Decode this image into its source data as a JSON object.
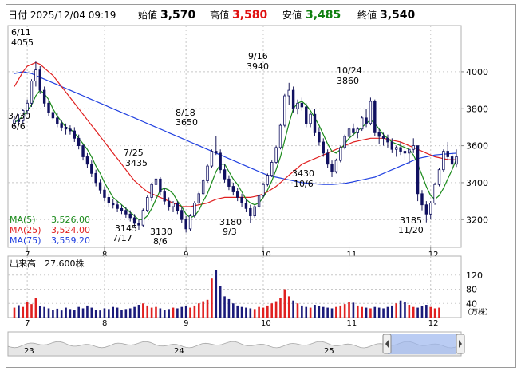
{
  "header": {
    "datetime_label": "日付 2025/12/04 09:19",
    "open_label": "始値",
    "open_value": "3,570",
    "high_label": "高値",
    "high_value": "3,580",
    "low_label": "安値",
    "low_value": "3,485",
    "close_label": "終値",
    "close_value": "3,540",
    "high_color": "#e01010",
    "low_color": "#108010"
  },
  "legend": {
    "ma5": "MA(5)",
    "ma5_value": "3,526.00",
    "ma25": "MA(25)",
    "ma25_value": "3,524.00",
    "ma75": "MA(75)",
    "ma75_value": "3,559.20",
    "ma5_color": "#1a8a1a",
    "ma25_color": "#e02020",
    "ma75_color": "#2040e0"
  },
  "annotations": [
    {
      "text": "6/11",
      "price": "4055"
    },
    {
      "text": "3730",
      "price": "6/6"
    },
    {
      "text": "7/25",
      "price": "3435"
    },
    {
      "text": "3145",
      "price": "7/17"
    },
    {
      "text": "8/18",
      "price": "3650"
    },
    {
      "text": "3130",
      "price": "8/6"
    },
    {
      "text": "9/16",
      "price": "3940"
    },
    {
      "text": "3180",
      "price": "9/3"
    },
    {
      "text": "10/24",
      "price": "3860"
    },
    {
      "text": "3430",
      "price": "10/6"
    },
    {
      "text": "3185",
      "price": "11/20"
    }
  ],
  "volume_panel": {
    "title": "出来高",
    "value": "27,600株",
    "unit": "（万株）",
    "yticks": [
      "120",
      "80",
      "40"
    ]
  },
  "chart_data": {
    "type": "candlestick",
    "x_months": [
      "7",
      "8",
      "9",
      "10",
      "11",
      "12"
    ],
    "y_ticks": [
      "4000",
      "3800",
      "3600",
      "3400",
      "3200"
    ],
    "ylim": [
      3050,
      4250
    ],
    "ohlc": [
      [
        3720,
        3760,
        3700,
        3740
      ],
      [
        3740,
        3770,
        3710,
        3730
      ],
      [
        3735,
        3800,
        3720,
        3790
      ],
      [
        3790,
        3850,
        3770,
        3830
      ],
      [
        3830,
        3960,
        3810,
        3950
      ],
      [
        3950,
        4055,
        3920,
        4010
      ],
      [
        4010,
        4030,
        3880,
        3900
      ],
      [
        3900,
        3920,
        3810,
        3830
      ],
      [
        3830,
        3850,
        3760,
        3780
      ],
      [
        3780,
        3800,
        3740,
        3750
      ],
      [
        3750,
        3780,
        3700,
        3720
      ],
      [
        3720,
        3740,
        3680,
        3700
      ],
      [
        3700,
        3720,
        3660,
        3690
      ],
      [
        3690,
        3710,
        3660,
        3680
      ],
      [
        3680,
        3700,
        3620,
        3640
      ],
      [
        3640,
        3660,
        3580,
        3600
      ],
      [
        3600,
        3610,
        3520,
        3540
      ],
      [
        3540,
        3560,
        3480,
        3500
      ],
      [
        3500,
        3520,
        3430,
        3450
      ],
      [
        3450,
        3470,
        3380,
        3400
      ],
      [
        3400,
        3420,
        3340,
        3360
      ],
      [
        3360,
        3380,
        3300,
        3320
      ],
      [
        3320,
        3340,
        3270,
        3290
      ],
      [
        3290,
        3310,
        3260,
        3280
      ],
      [
        3280,
        3300,
        3240,
        3260
      ],
      [
        3260,
        3280,
        3230,
        3250
      ],
      [
        3250,
        3270,
        3210,
        3230
      ],
      [
        3230,
        3250,
        3190,
        3210
      ],
      [
        3210,
        3230,
        3160,
        3180
      ],
      [
        3180,
        3200,
        3145,
        3170
      ],
      [
        3170,
        3260,
        3160,
        3250
      ],
      [
        3250,
        3330,
        3240,
        3320
      ],
      [
        3320,
        3400,
        3300,
        3390
      ],
      [
        3390,
        3435,
        3370,
        3420
      ],
      [
        3420,
        3430,
        3330,
        3350
      ],
      [
        3350,
        3370,
        3280,
        3300
      ],
      [
        3300,
        3320,
        3250,
        3270
      ],
      [
        3270,
        3300,
        3240,
        3290
      ],
      [
        3290,
        3300,
        3230,
        3250
      ],
      [
        3250,
        3270,
        3180,
        3200
      ],
      [
        3200,
        3220,
        3130,
        3150
      ],
      [
        3150,
        3230,
        3140,
        3220
      ],
      [
        3220,
        3300,
        3210,
        3290
      ],
      [
        3290,
        3350,
        3280,
        3340
      ],
      [
        3340,
        3420,
        3330,
        3410
      ],
      [
        3410,
        3500,
        3400,
        3490
      ],
      [
        3490,
        3580,
        3480,
        3570
      ],
      [
        3570,
        3650,
        3550,
        3560
      ],
      [
        3560,
        3580,
        3450,
        3470
      ],
      [
        3470,
        3500,
        3400,
        3420
      ],
      [
        3420,
        3440,
        3360,
        3380
      ],
      [
        3380,
        3400,
        3330,
        3350
      ],
      [
        3350,
        3370,
        3300,
        3320
      ],
      [
        3320,
        3340,
        3270,
        3290
      ],
      [
        3290,
        3310,
        3240,
        3260
      ],
      [
        3260,
        3280,
        3180,
        3220
      ],
      [
        3220,
        3280,
        3210,
        3270
      ],
      [
        3270,
        3340,
        3260,
        3330
      ],
      [
        3330,
        3400,
        3320,
        3390
      ],
      [
        3390,
        3450,
        3380,
        3440
      ],
      [
        3440,
        3520,
        3430,
        3510
      ],
      [
        3510,
        3600,
        3500,
        3590
      ],
      [
        3590,
        3720,
        3580,
        3710
      ],
      [
        3710,
        3880,
        3700,
        3870
      ],
      [
        3870,
        3940,
        3820,
        3900
      ],
      [
        3900,
        3920,
        3780,
        3800
      ],
      [
        3800,
        3850,
        3770,
        3830
      ],
      [
        3830,
        3860,
        3790,
        3810
      ],
      [
        3810,
        3830,
        3700,
        3720
      ],
      [
        3720,
        3780,
        3700,
        3770
      ],
      [
        3770,
        3800,
        3650,
        3670
      ],
      [
        3670,
        3700,
        3600,
        3620
      ],
      [
        3620,
        3640,
        3540,
        3560
      ],
      [
        3560,
        3580,
        3480,
        3500
      ],
      [
        3500,
        3520,
        3430,
        3460
      ],
      [
        3460,
        3530,
        3450,
        3520
      ],
      [
        3520,
        3600,
        3510,
        3590
      ],
      [
        3590,
        3660,
        3580,
        3650
      ],
      [
        3650,
        3700,
        3630,
        3690
      ],
      [
        3690,
        3720,
        3650,
        3670
      ],
      [
        3670,
        3700,
        3640,
        3690
      ],
      [
        3690,
        3760,
        3680,
        3750
      ],
      [
        3750,
        3800,
        3700,
        3720
      ],
      [
        3720,
        3860,
        3710,
        3840
      ],
      [
        3840,
        3850,
        3650,
        3670
      ],
      [
        3670,
        3690,
        3610,
        3650
      ],
      [
        3650,
        3670,
        3600,
        3640
      ],
      [
        3640,
        3660,
        3590,
        3620
      ],
      [
        3620,
        3640,
        3560,
        3580
      ],
      [
        3580,
        3600,
        3540,
        3590
      ],
      [
        3590,
        3620,
        3550,
        3570
      ],
      [
        3570,
        3590,
        3520,
        3560
      ],
      [
        3560,
        3580,
        3500,
        3580
      ],
      [
        3580,
        3640,
        3560,
        3600
      ],
      [
        3600,
        3450,
        3300,
        3340
      ],
      [
        3340,
        3360,
        3250,
        3280
      ],
      [
        3280,
        3300,
        3185,
        3230
      ],
      [
        3230,
        3300,
        3200,
        3290
      ],
      [
        3290,
        3400,
        3280,
        3390
      ],
      [
        3390,
        3480,
        3380,
        3470
      ],
      [
        3470,
        3580,
        3460,
        3570
      ],
      [
        3570,
        3620,
        3520,
        3540
      ],
      [
        3540,
        3560,
        3470,
        3500
      ],
      [
        3500,
        3580,
        3485,
        3540
      ]
    ],
    "volume": [
      28,
      35,
      30,
      45,
      38,
      55,
      32,
      30,
      26,
      22,
      25,
      20,
      28,
      24,
      22,
      30,
      26,
      34,
      28,
      22,
      20,
      26,
      24,
      30,
      28,
      22,
      24,
      26,
      30,
      36,
      40,
      34,
      28,
      30,
      26,
      22,
      24,
      28,
      26,
      30,
      32,
      28,
      34,
      40,
      46,
      50,
      110,
      135,
      90,
      60,
      52,
      40,
      34,
      30,
      28,
      26,
      24,
      30,
      28,
      34,
      40,
      46,
      56,
      80,
      60,
      48,
      40,
      34,
      30,
      28,
      36,
      32,
      30,
      28,
      26,
      30,
      34,
      38,
      44,
      42,
      34,
      30,
      28,
      26,
      30,
      28,
      26,
      30,
      34,
      40,
      48,
      44,
      36,
      30,
      28,
      32,
      36,
      30,
      26,
      28
    ],
    "ma5": [
      3725,
      3740,
      3760,
      3790,
      3820,
      3870,
      3900,
      3880,
      3850,
      3800,
      3760,
      3730,
      3700,
      3690,
      3670,
      3640,
      3610,
      3580,
      3540,
      3490,
      3450,
      3400,
      3360,
      3320,
      3300,
      3280,
      3260,
      3240,
      3220,
      3200,
      3200,
      3220,
      3260,
      3310,
      3360,
      3370,
      3360,
      3340,
      3300,
      3270,
      3230,
      3210,
      3220,
      3250,
      3300,
      3340,
      3400,
      3460,
      3500,
      3500,
      3460,
      3420,
      3390,
      3350,
      3310,
      3290,
      3280,
      3290,
      3320,
      3360,
      3410,
      3470,
      3540,
      3630,
      3720,
      3800,
      3830,
      3840,
      3820,
      3790,
      3750,
      3710,
      3660,
      3610,
      3570,
      3560,
      3580,
      3610,
      3640,
      3660,
      3680,
      3700,
      3720,
      3740,
      3720,
      3690,
      3660,
      3640,
      3620,
      3610,
      3600,
      3590,
      3580,
      3550,
      3500,
      3440,
      3380,
      3330,
      3310,
      3330,
      3370,
      3420,
      3470,
      3526
    ],
    "ma25": [
      3920,
      3960,
      4000,
      4030,
      4040,
      4050,
      4040,
      4020,
      4000,
      3980,
      3950,
      3920,
      3890,
      3860,
      3830,
      3800,
      3770,
      3740,
      3710,
      3680,
      3650,
      3620,
      3590,
      3560,
      3530,
      3500,
      3470,
      3440,
      3410,
      3390,
      3370,
      3350,
      3340,
      3330,
      3320,
      3310,
      3300,
      3290,
      3280,
      3270,
      3270,
      3270,
      3275,
      3280,
      3285,
      3290,
      3300,
      3310,
      3315,
      3320,
      3320,
      3320,
      3320,
      3320,
      3320,
      3320,
      3325,
      3330,
      3340,
      3350,
      3365,
      3380,
      3400,
      3420,
      3440,
      3460,
      3480,
      3500,
      3510,
      3520,
      3530,
      3540,
      3550,
      3560,
      3570,
      3580,
      3590,
      3600,
      3610,
      3620,
      3625,
      3630,
      3635,
      3640,
      3640,
      3640,
      3640,
      3635,
      3630,
      3625,
      3620,
      3610,
      3600,
      3590,
      3580,
      3570,
      3560,
      3550,
      3540,
      3535,
      3530,
      3525,
      3524,
      3524
    ],
    "ma75": [
      3990,
      3995,
      4000,
      3995,
      3990,
      3980,
      3970,
      3960,
      3950,
      3940,
      3930,
      3920,
      3910,
      3900,
      3890,
      3880,
      3870,
      3860,
      3850,
      3840,
      3830,
      3820,
      3810,
      3800,
      3790,
      3780,
      3770,
      3760,
      3750,
      3740,
      3730,
      3720,
      3710,
      3700,
      3690,
      3680,
      3670,
      3660,
      3650,
      3640,
      3630,
      3620,
      3610,
      3600,
      3590,
      3580,
      3570,
      3560,
      3550,
      3540,
      3530,
      3520,
      3510,
      3500,
      3490,
      3480,
      3470,
      3460,
      3450,
      3440,
      3435,
      3430,
      3425,
      3420,
      3415,
      3410,
      3405,
      3400,
      3398,
      3396,
      3394,
      3392,
      3390,
      3390,
      3390,
      3392,
      3394,
      3396,
      3400,
      3405,
      3410,
      3415,
      3420,
      3425,
      3430,
      3440,
      3450,
      3460,
      3470,
      3480,
      3490,
      3500,
      3510,
      3520,
      3530,
      3535,
      3540,
      3545,
      3550,
      3552,
      3554,
      3556,
      3558,
      3559.2
    ]
  },
  "navigator": {
    "labels": [
      "23",
      "24",
      "25"
    ]
  }
}
